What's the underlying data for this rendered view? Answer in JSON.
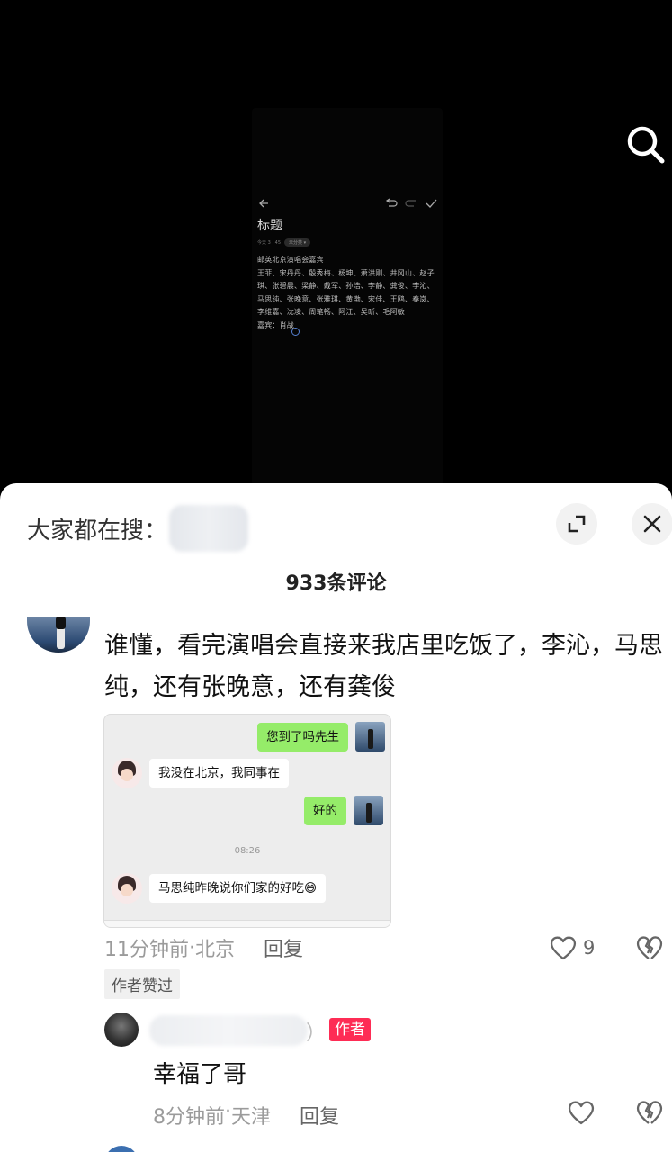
{
  "video": {
    "phone_title": "标题",
    "phone_meta": "今天 3 | 45",
    "phone_meta_chip": "未分类 ▾",
    "phone_body": "邮英北京演唱会嘉宾\n王菲、宋丹丹、殷秀梅、杨坤、萧洪刚、井冈山、赵子琪、张碧晨、梁静、戴军、孙浩、李静、龚俊、李沁、马思纯、张晚意、张雅琪、黄渤、宋佳、王鸥、秦岚、李维嘉、沈凌、周笔畅、阿江、吴昕、毛阿敏\n嘉宾：肖战"
  },
  "sheet": {
    "search_label": "大家都在搜：",
    "comment_count_title": "933条评论"
  },
  "comment": {
    "text": "谁懂，看完演唱会直接来我店里吃饭了，李沁，马思纯，还有张晚意，还有龚俊",
    "time": "11分钟前",
    "location": "北京",
    "reply_label": "回复",
    "like_count": "9",
    "author_liked": "作者赞过",
    "attachment": {
      "msg1": "您到了吗先生",
      "msg2": "我没在北京，我同事在",
      "msg3": "好的",
      "time": "08:26",
      "msg4": "马思纯昨晚说你们家的好吃😄"
    }
  },
  "reply": {
    "name_tail": "）",
    "author_badge": "作者",
    "text": "幸福了哥",
    "time": "8分钟前",
    "location": "天津",
    "reply_label": "回复"
  },
  "separator": " · ",
  "colors": {
    "accent": "#fe2c55",
    "wechat_green": "#95ec69"
  }
}
